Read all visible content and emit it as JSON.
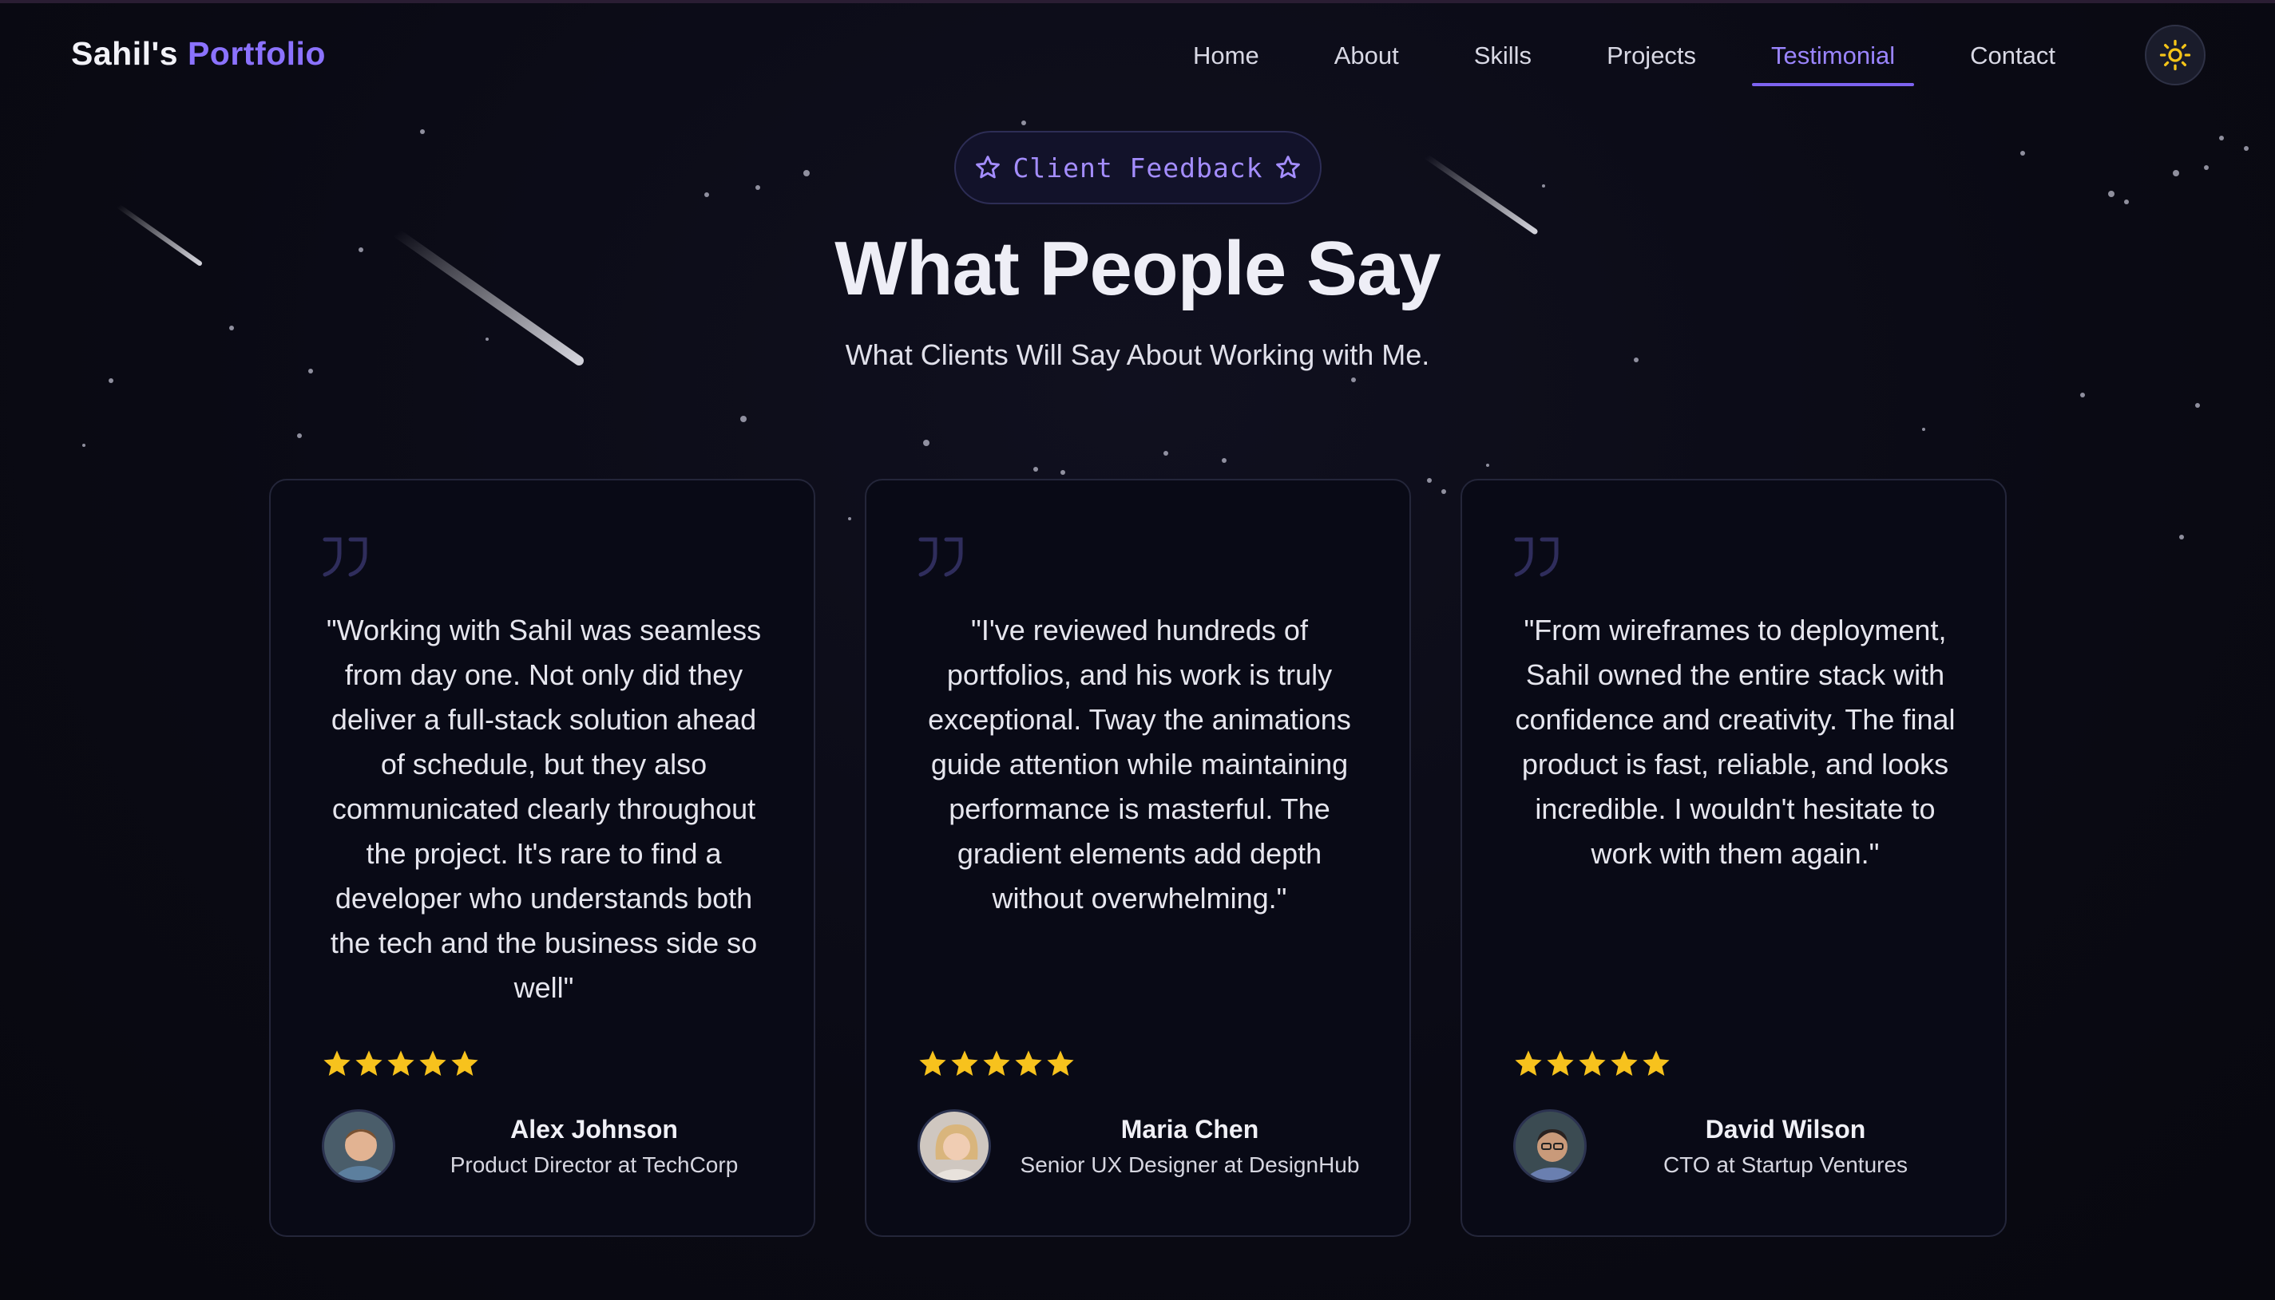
{
  "nav": {
    "logo_main": "Sahil's",
    "logo_accent": "Portfolio",
    "links": [
      {
        "label": "Home",
        "active": false
      },
      {
        "label": "About",
        "active": false
      },
      {
        "label": "Skills",
        "active": false
      },
      {
        "label": "Projects",
        "active": false
      },
      {
        "label": "Testimonial",
        "active": true
      },
      {
        "label": "Contact",
        "active": false
      }
    ],
    "theme_icon": "sun-icon"
  },
  "header": {
    "badge": "Client Feedback",
    "title": "What People Say",
    "subtitle": "What Clients Will Say About Working with Me."
  },
  "testimonials": [
    {
      "quote": "\"Working with Sahil was seamless from day one. Not only did they deliver a full-stack solution ahead of schedule, but they also communicated clearly throughout the project. It's rare to find a developer who understands both the tech and the business side so well\"",
      "rating": 5,
      "name": "Alex Johnson",
      "role": "Product Director at TechCorp"
    },
    {
      "quote": "\"I've reviewed hundreds of portfolios, and his work is truly exceptional. Tway the animations guide attention while maintaining performance is masterful. The gradient elements add depth without overwhelming.\"",
      "rating": 5,
      "name": "Maria Chen",
      "role": "Senior UX Designer at DesignHub"
    },
    {
      "quote": "\"From wireframes to deployment, Sahil owned the entire stack with confidence and creativity. The final product is fast, reliable, and looks incredible. I wouldn't hesitate to work with them again.\"",
      "rating": 5,
      "name": "David Wilson",
      "role": "CTO at Startup Ventures"
    }
  ],
  "colors": {
    "accent": "#8b72ff",
    "star": "#f7c21d",
    "background": "#0a0a14",
    "card_border": "#24263a"
  }
}
